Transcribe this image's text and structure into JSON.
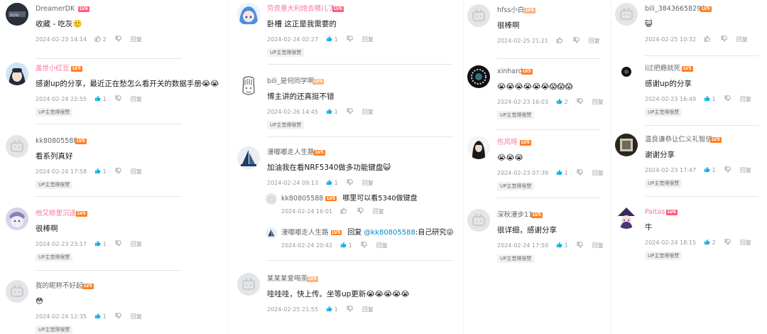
{
  "ui": {
    "reply_label": "回复",
    "up_liked_tag": "UP主觉得很赞"
  },
  "colors": {
    "like_active": "#00aeec",
    "name_pink": "#fb7299",
    "name_grey": "#61666d",
    "mention": "#008ac5"
  },
  "columns": [
    {
      "comments": [
        {
          "user": "DreamerDK",
          "level": "LV6",
          "name_color": "grey",
          "text": "收藏 - 吃灰🙂",
          "date": "2024-02-23 14:14",
          "likes": "2",
          "up_tag": false,
          "avatar_icon": "dark-photo-avatar"
        },
        {
          "user": "盖世小红豆",
          "level": "LV5",
          "name_color": "pink",
          "text": "感谢up的分享，最近正在愁怎么看开关的数据手册😭😭",
          "date": "2024-02-24 22:55",
          "likes": "1",
          "up_tag": true,
          "avatar_icon": "anime-girl-avatar"
        },
        {
          "user": "kk80805588",
          "level": "LV5",
          "name_color": "grey",
          "text": "看系列真好",
          "date": "2024-02-24 17:58",
          "likes": "1",
          "up_tag": true,
          "avatar_icon": "default-tv-avatar"
        },
        {
          "user": "他又晾里沉送",
          "level": "LV5",
          "name_color": "pink",
          "text": "很棒啊",
          "date": "2024-02-23 23:17",
          "likes": "1",
          "up_tag": true,
          "avatar_icon": "anime-purple-avatar"
        },
        {
          "user": "我的昵称不好起",
          "level": "LV5",
          "name_color": "grey",
          "text": "😳",
          "date": "2024-02-24 12:35",
          "likes": "1",
          "up_tag": true,
          "avatar_icon": "default-tv-avatar"
        }
      ]
    },
    {
      "comments": [
        {
          "user": "劳资意大利炮去哪儿了",
          "level": "LV6",
          "name_color": "pink",
          "text": "卧槽 这正是我需要的",
          "date": "2024-02-24 02:27",
          "likes": "1",
          "up_tag": true,
          "avatar_icon": "anime-blue-avatar"
        },
        {
          "user": "bili_是何同学啊",
          "level": "LV4",
          "name_color": "grey",
          "text": "博主讲的还真挺不错",
          "date": "2024-02-26 14:45",
          "likes": "1",
          "up_tag": true,
          "avatar_icon": "sketch-face-avatar"
        },
        {
          "user": "漫嘟嘟走人生路",
          "level": "LV5",
          "name_color": "grey",
          "text": "加油我在看NRF5340做多功能键盘😺",
          "date": "2024-02-24 09:13",
          "likes": "1",
          "up_tag": false,
          "avatar_icon": "sailboat-avatar",
          "replies": [
            {
              "user": "kk80805588",
              "level": "LV5",
              "text": "哪里可以看5340做键盘",
              "date": "2024-02-24 16:01",
              "likes": "",
              "avatar_icon": "default-tv-avatar"
            },
            {
              "user": "漫嘟嘟走人生路",
              "level": "LV5",
              "reply_prefix": "回复",
              "mention": "@kk80805588",
              "text": ":自己研究😜",
              "date": "2024-02-24 20:42",
              "likes": "1",
              "avatar_icon": "sailboat-avatar"
            }
          ]
        },
        {
          "user": "某某某爱喝茶",
          "level": "LV4",
          "name_color": "grey",
          "text": "哇哇哇，快上传。坐等up更新😭😭😭😭😭",
          "date": "2024-02-25 21:55",
          "likes": "1",
          "up_tag": false,
          "avatar_icon": "default-tv-avatar"
        }
      ]
    },
    {
      "comments": [
        {
          "user": "hfss小白",
          "level": "LV4",
          "name_color": "grey",
          "text": "很棒啊",
          "date": "2024-02-25 21:21",
          "likes": "",
          "up_tag": false,
          "avatar_icon": "default-tv-avatar"
        },
        {
          "user": "xinhard",
          "level": "LV5",
          "name_color": "grey",
          "text": "😭😭😭😭😭😭😱😱😱",
          "date": "2024-02-23 16:03",
          "likes": "2",
          "up_tag": true,
          "avatar_icon": "ring-logo-avatar"
        },
        {
          "user": "伤风呀",
          "level": "LV5",
          "name_color": "pink",
          "text": "😭😭😭",
          "date": "2024-02-23 07:39",
          "likes": "1",
          "up_tag": true,
          "avatar_icon": "dark-hair-avatar"
        },
        {
          "user": "深秋漫步11",
          "level": "LV5",
          "name_color": "grey",
          "text": "很详细，感谢分享",
          "date": "2024-02-24 17:50",
          "likes": "1",
          "up_tag": true,
          "avatar_icon": "default-tv-avatar"
        }
      ]
    },
    {
      "comments": [
        {
          "user": "bili_38436658290",
          "level": "LV5",
          "name_color": "grey",
          "text": "😺",
          "date": "2024-02-25 10:32",
          "likes": "",
          "up_tag": false,
          "avatar_icon": "default-tv-avatar"
        },
        {
          "user": "l过把瘾就死",
          "level": "LV5",
          "name_color": "grey",
          "text": "感谢up的分享",
          "date": "2024-02-23 16:49",
          "likes": "1",
          "up_tag": true,
          "avatar_icon": "black-dot-avatar"
        },
        {
          "user": "温良谦恭让仁义礼智信",
          "level": "LV5",
          "name_color": "grey",
          "text": "谢谢分享",
          "date": "2024-02-23 17:47",
          "likes": "1",
          "up_tag": true,
          "avatar_icon": "framed-photo-avatar"
        },
        {
          "user": "Paitas",
          "level": "LV6",
          "name_color": "pink",
          "text": "牛",
          "date": "2024-02-24 18:15",
          "likes": "2",
          "up_tag": true,
          "avatar_icon": "anime-hat-avatar"
        }
      ]
    }
  ]
}
